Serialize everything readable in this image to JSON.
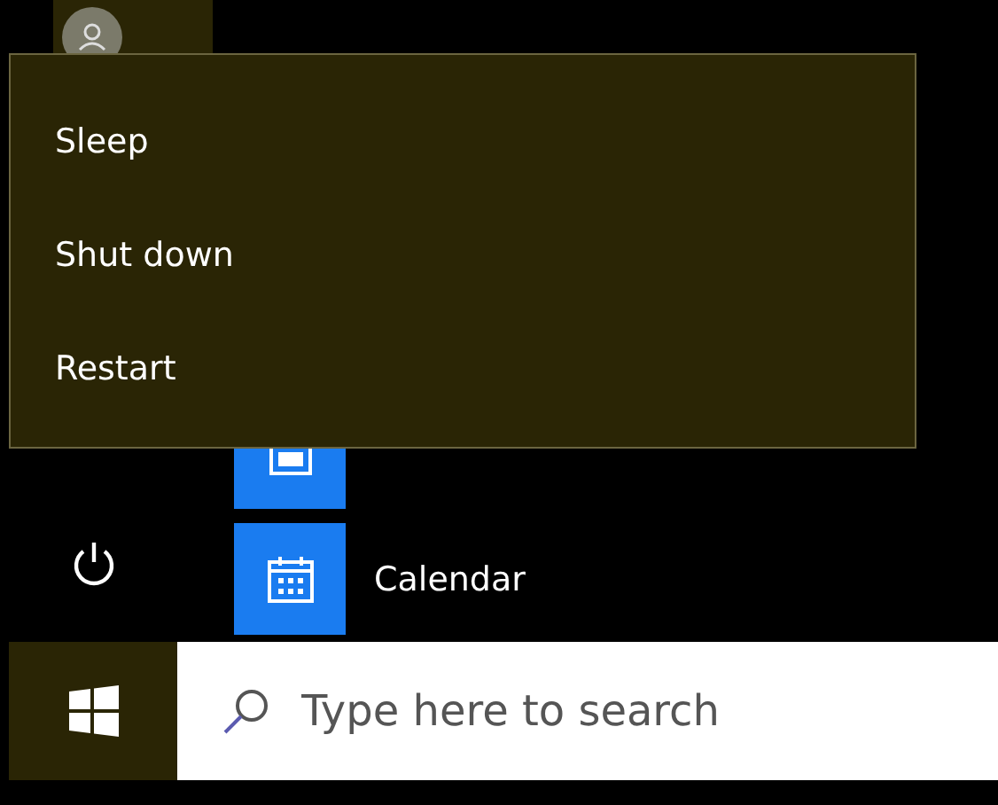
{
  "power_menu": {
    "items": [
      {
        "label": "Sleep"
      },
      {
        "label": "Shut down"
      },
      {
        "label": "Restart"
      }
    ]
  },
  "apps": [
    {
      "kind": "calculator"
    },
    {
      "name": "Calendar",
      "kind": "calendar"
    }
  ],
  "search": {
    "placeholder": "Type here to search"
  }
}
